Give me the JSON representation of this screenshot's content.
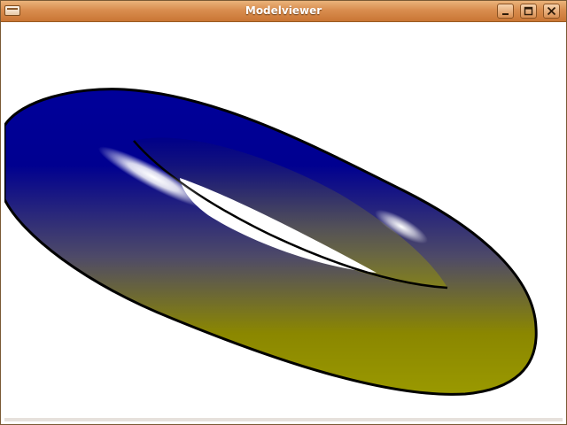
{
  "window": {
    "title": "Modelviewer"
  },
  "titlebar_buttons": {
    "menu_icon": "window-menu-icon",
    "minimize_icon": "minimize-icon",
    "maximize_icon": "maximize-icon",
    "close_icon": "close-icon"
  },
  "model": {
    "shape": "torus",
    "colors": {
      "top": "#00009a",
      "bottom": "#9a9900",
      "highlight": "#ffffff",
      "outline": "#000000"
    }
  }
}
